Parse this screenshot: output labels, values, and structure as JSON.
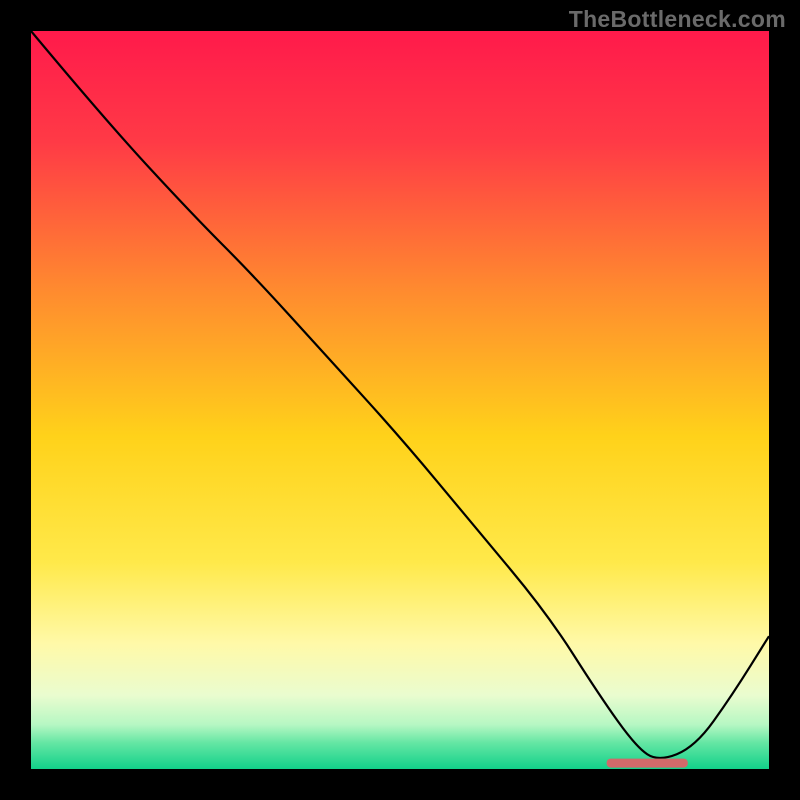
{
  "watermark": "TheBottleneck.com",
  "chart_data": {
    "type": "line",
    "title": "",
    "xlabel": "",
    "ylabel": "",
    "xlim": [
      0,
      100
    ],
    "ylim": [
      0,
      100
    ],
    "grid": false,
    "legend": false,
    "annotations": [],
    "series": [
      {
        "name": "curve",
        "x": [
          0,
          10,
          22,
          30,
          40,
          50,
          60,
          70,
          77,
          82,
          85,
          90,
          95,
          100
        ],
        "y": [
          100,
          88,
          75,
          67,
          56,
          45,
          33,
          21,
          10,
          3,
          1,
          3,
          10,
          18
        ]
      }
    ],
    "optimum_marker": {
      "x_start": 78,
      "x_end": 89,
      "y": 0.8
    },
    "background_gradient": {
      "stops": [
        {
          "offset": 0.0,
          "color": "#ff1a4b"
        },
        {
          "offset": 0.15,
          "color": "#ff3a46"
        },
        {
          "offset": 0.35,
          "color": "#ff8a2f"
        },
        {
          "offset": 0.55,
          "color": "#ffd21a"
        },
        {
          "offset": 0.72,
          "color": "#ffe94a"
        },
        {
          "offset": 0.83,
          "color": "#fff9a8"
        },
        {
          "offset": 0.9,
          "color": "#eafccf"
        },
        {
          "offset": 0.94,
          "color": "#b6f7c3"
        },
        {
          "offset": 0.965,
          "color": "#63e6a3"
        },
        {
          "offset": 1.0,
          "color": "#12d18a"
        }
      ]
    },
    "marker_color": "#d16a6a",
    "curve_color": "#000000"
  }
}
